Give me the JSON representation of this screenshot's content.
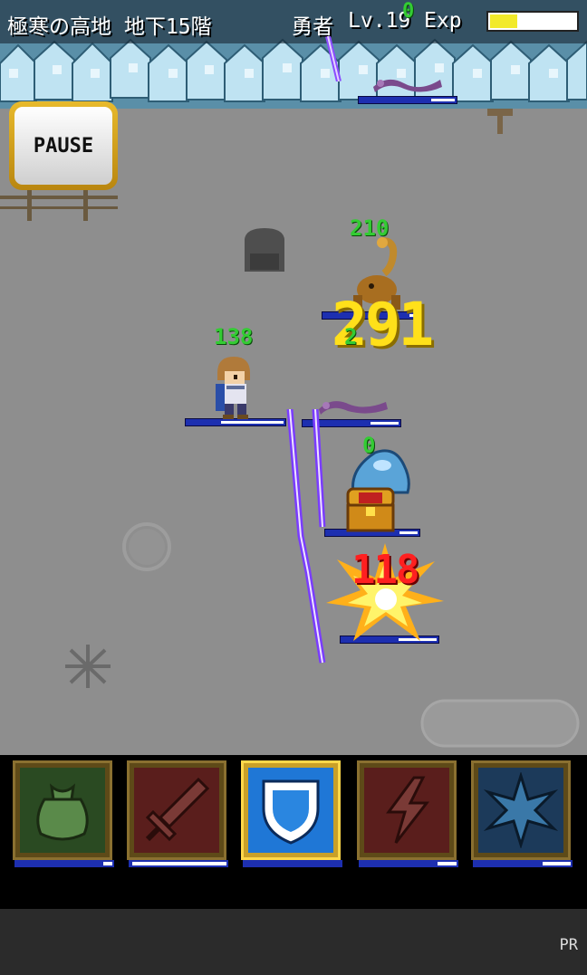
{
  "status_bar": {
    "location": "極寒の高地 地下15階",
    "hero_name": "勇者",
    "hero_level": "Lv.19",
    "exp_label": "Exp",
    "exp_progress": 0.32
  },
  "pause_button": {
    "label": "PAUSE"
  },
  "battle": {
    "hero_hp_label": "138",
    "hero_hp_ratio": 0.65,
    "numbers": {
      "top_enemy_value": "0",
      "scorpion_value": "210",
      "big_damage": "291",
      "small_green": "2",
      "slime_value": "0",
      "red_damage": "118"
    },
    "enemy_hp_ratios": {
      "top_worm": 0.25,
      "scorpion": 0.1,
      "purple_worm": 0.3,
      "chest_blob": 0.2,
      "lower_enemy": 0.4
    }
  },
  "skills": [
    {
      "name": "item-bag",
      "icon": "bag-icon",
      "color": "#2a4a22",
      "cooldown": 0.1
    },
    {
      "name": "sword",
      "icon": "sword-icon",
      "color": "#5a1e1c",
      "cooldown": 1.0
    },
    {
      "name": "shield",
      "icon": "shield-icon",
      "color": "#1f77d6",
      "cooldown": 0.0,
      "active": true
    },
    {
      "name": "lightning",
      "icon": "lightning-icon",
      "color": "#5a1e1c",
      "cooldown": 0.2
    },
    {
      "name": "burst",
      "icon": "burst-icon",
      "color": "#1c3a5a",
      "cooldown": 0.3
    }
  ],
  "ad_bar": {
    "label": "PR"
  }
}
